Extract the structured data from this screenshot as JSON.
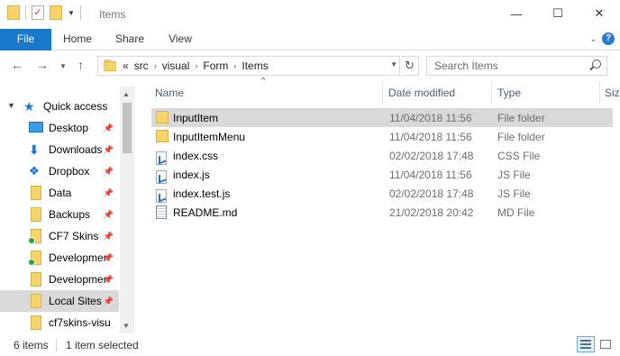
{
  "window": {
    "title": "Items",
    "minimize_glyph": "—",
    "maximize_glyph": "☐",
    "close_glyph": "✕"
  },
  "ribbon": {
    "tabs": [
      "File",
      "Home",
      "Share",
      "View"
    ],
    "help_glyph": "?"
  },
  "address": {
    "overflow": "«",
    "crumbs": [
      "src",
      "visual",
      "Form",
      "Items"
    ],
    "search_placeholder": "Search Items"
  },
  "nav": {
    "quick_access": "Quick access",
    "items": [
      {
        "label": "Desktop",
        "icon": "desktop-icon",
        "pinned": true
      },
      {
        "label": "Downloads",
        "icon": "download-icon",
        "pinned": true
      },
      {
        "label": "Dropbox",
        "icon": "dropbox-icon",
        "pinned": true
      },
      {
        "label": "Data",
        "icon": "folder-icon",
        "pinned": true
      },
      {
        "label": "Backups",
        "icon": "folder-icon",
        "pinned": true
      },
      {
        "label": "CF7 Skins",
        "icon": "synced-folder-icon",
        "pinned": true
      },
      {
        "label": "Developmen",
        "icon": "synced-folder-icon",
        "pinned": true
      },
      {
        "label": "Developmen",
        "icon": "folder-icon",
        "pinned": true
      },
      {
        "label": "Local Sites",
        "icon": "folder-icon",
        "pinned": true,
        "selected": true
      },
      {
        "label": "cf7skins-visu",
        "icon": "folder-icon",
        "pinned": false
      }
    ]
  },
  "columns": {
    "name": "Name",
    "date": "Date modified",
    "type": "Type",
    "size": "Siz"
  },
  "files": [
    {
      "name": "InputItem",
      "date": "11/04/2018 11:56",
      "type": "File folder",
      "icon": "folder-icon",
      "selected": true
    },
    {
      "name": "InputItemMenu",
      "date": "11/04/2018 11:56",
      "type": "File folder",
      "icon": "folder-icon"
    },
    {
      "name": "index.css",
      "date": "02/02/2018 17:48",
      "type": "CSS File",
      "icon": "vscode-file-icon"
    },
    {
      "name": "index.js",
      "date": "11/04/2018 11:56",
      "type": "JS File",
      "icon": "vscode-file-icon"
    },
    {
      "name": "index.test.js",
      "date": "02/02/2018 17:48",
      "type": "JS File",
      "icon": "vscode-file-icon"
    },
    {
      "name": "README.md",
      "date": "21/02/2018 20:42",
      "type": "MD File",
      "icon": "markdown-file-icon"
    }
  ],
  "status": {
    "count": "6 items",
    "selection": "1 item selected"
  }
}
